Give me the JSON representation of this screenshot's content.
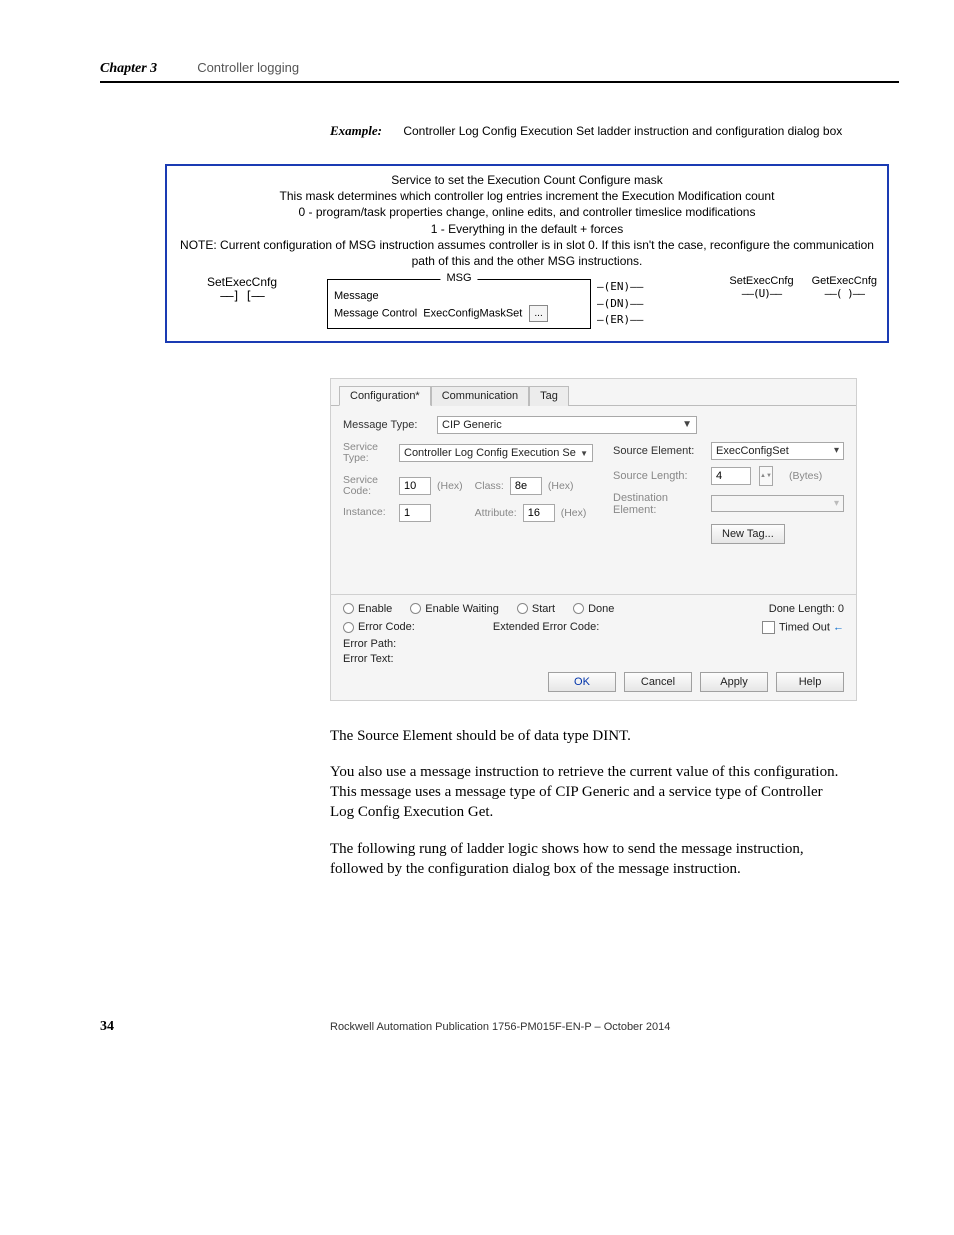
{
  "header": {
    "chapter": "Chapter 3",
    "title": "Controller logging"
  },
  "example": {
    "label": "Example:",
    "text": "Controller Log Config Execution Set ladder instruction and configuration dialog box"
  },
  "ladder": {
    "desc_l1": "Service to set the Execution Count Configure mask",
    "desc_l2": "This mask determines which controller log entries increment the Execution Modification count",
    "desc_l3": "0 - program/task properties change, online edits, and controller timeslice modifications",
    "desc_l4": "1 - Everything in the default + forces",
    "desc_l5": "NOTE: Current configuration of MSG instruction assumes controller is in slot 0. If this isn't the case, reconfigure the communication path of this and the other MSG instructions.",
    "left_tag": "SetExecCnfg",
    "left_contact": "——] [——",
    "msg_title": "MSG",
    "msg_l1": "Message",
    "msg_l2_label": "Message Control",
    "msg_l2_val": "ExecConfigMaskSet",
    "ellipsis": "...",
    "status_en": "—(EN)——",
    "status_dn": "—(DN)——",
    "status_er": "—(ER)——",
    "right1_tag": "SetExecCnfg",
    "right1_coil": "——(U)——",
    "right2_tag": "GetExecCnfg",
    "right2_coil": "——(  )——"
  },
  "dialog": {
    "tabs": {
      "t1": "Configuration*",
      "t2": "Communication",
      "t3": "Tag"
    },
    "msg_type_label": "Message Type:",
    "msg_type_value": "CIP Generic",
    "svc_type_label": "Service Type:",
    "svc_type_value": "Controller Log Config Execution Se",
    "svc_code_label": "Service Code:",
    "svc_code_value": "10",
    "instance_label": "Instance:",
    "instance_value": "1",
    "class_label": "Class:",
    "class_value": "8e",
    "attribute_label": "Attribute:",
    "attribute_value": "16",
    "hex": "(Hex)",
    "source_elem_label": "Source Element:",
    "source_elem_value": "ExecConfigSet",
    "source_len_label": "Source Length:",
    "source_len_value": "4",
    "bytes": "(Bytes)",
    "dest_elem_label": "Destination Element:",
    "new_tag": "New Tag...",
    "enable": "Enable",
    "enable_waiting": "Enable Waiting",
    "start": "Start",
    "done": "Done",
    "done_length_label": "Done Length:",
    "done_length_value": "0",
    "error_code": "Error Code:",
    "ext_error_code": "Extended Error Code:",
    "timed_out": "Timed Out",
    "error_path": "Error Path:",
    "error_text": "Error Text:",
    "ok": "OK",
    "cancel": "Cancel",
    "apply": "Apply",
    "help": "Help"
  },
  "body": {
    "p1": "The Source Element should be of data type DINT.",
    "p2": "You also use a message instruction to retrieve the current value of this configuration. This message uses a message type of CIP Generic and a service type of Controller Log Config Execution Get.",
    "p3": "The following rung of ladder logic shows how to send the message instruction, followed by the configuration dialog box of the message instruction."
  },
  "footer": {
    "page": "34",
    "pub": "Rockwell Automation Publication 1756-PM015F-EN-P – October 2014"
  }
}
